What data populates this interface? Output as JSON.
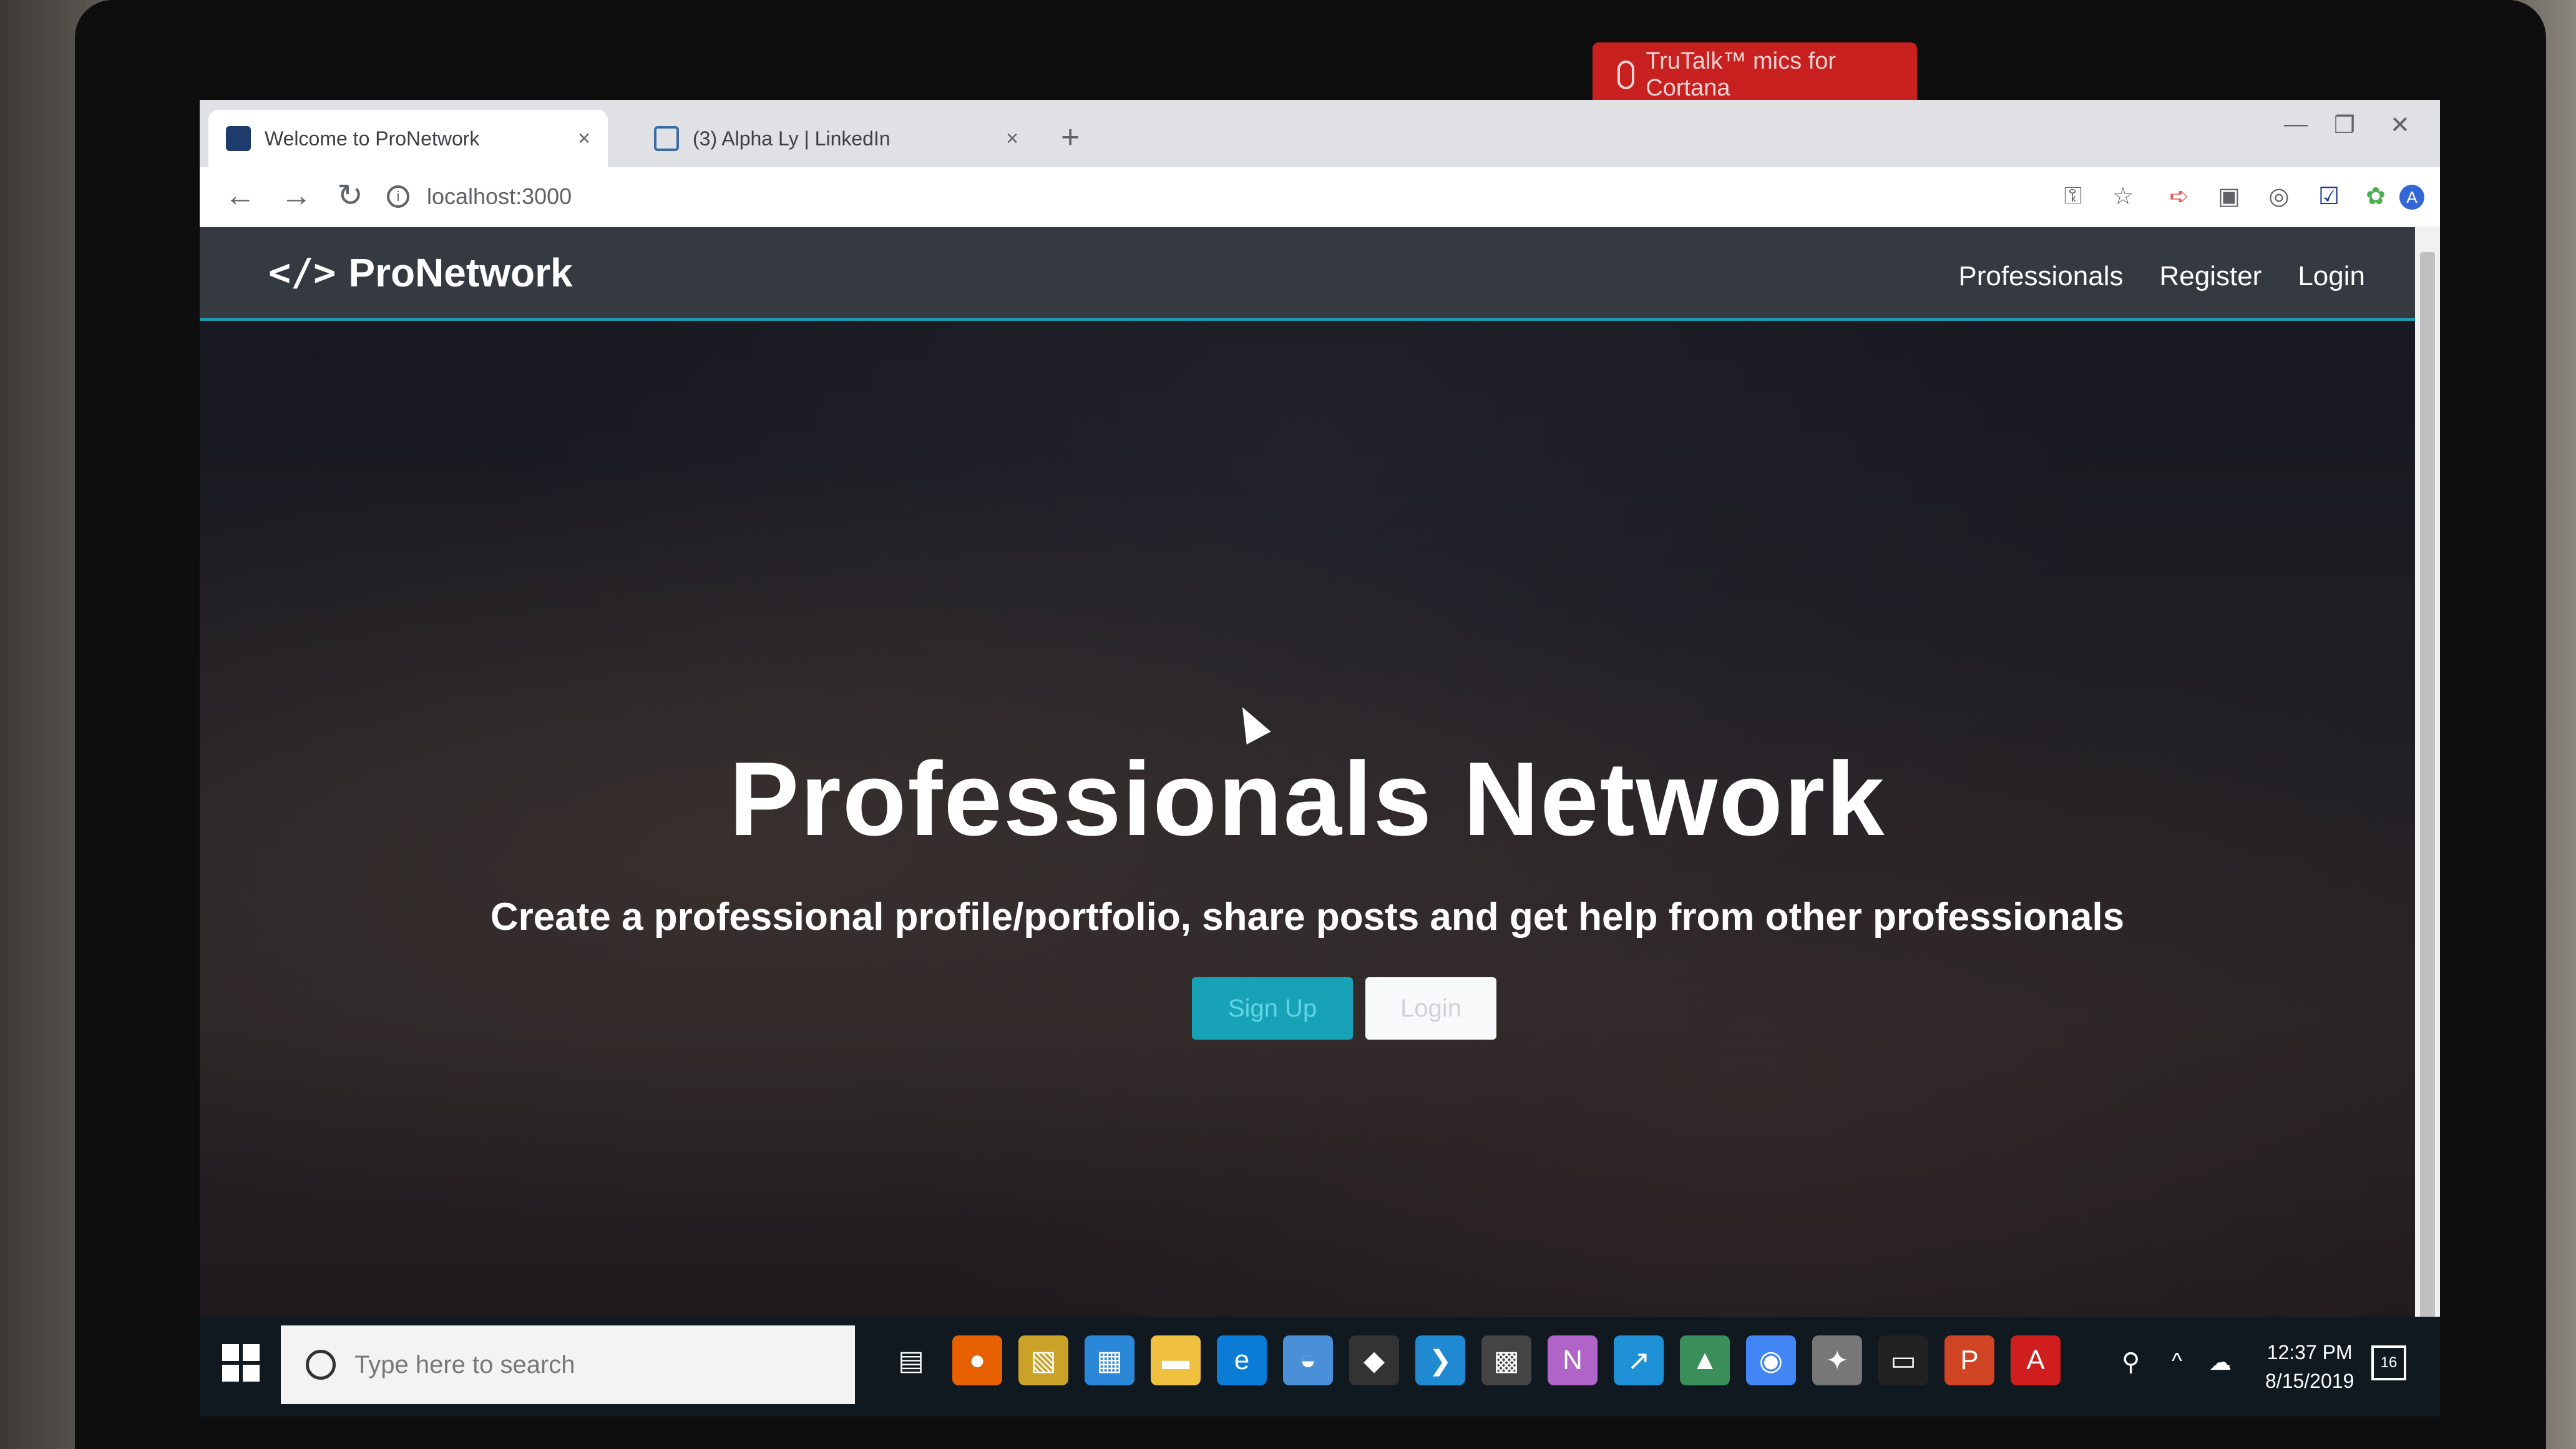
{
  "badge": {
    "text": "TruTalk™ mics for Cortana"
  },
  "browser": {
    "tabs": [
      {
        "title": "Welcome to ProNetwork",
        "active": true
      },
      {
        "title": "(3) Alpha Ly | LinkedIn",
        "active": false
      }
    ],
    "close_glyph": "×",
    "new_tab_glyph": "+",
    "address": "localhost:3000",
    "info_glyph": "i",
    "back_glyph": "←",
    "forward_glyph": "→",
    "reload_glyph": "↻",
    "profile_initial": "A",
    "window_controls": {
      "minimize": "—",
      "restore": "❐",
      "close": "✕"
    },
    "toolbar_icons": {
      "key": "⚿",
      "star": "☆",
      "menu": "⋮"
    }
  },
  "site": {
    "brand": {
      "icon": "</>",
      "name": "ProNetwork"
    },
    "nav": [
      "Professionals",
      "Register",
      "Login"
    ],
    "hero": {
      "title": "Professionals Network",
      "subtitle": "Create a professional profile/portfolio, share posts and get help from other professionals",
      "signup_label": "Sign Up",
      "login_label": "Login"
    }
  },
  "taskbar": {
    "search_placeholder": "Type here to search",
    "time": "12:37 PM",
    "date": "8/15/2019",
    "notification_count": "16",
    "apps": [
      {
        "name": "task-view",
        "glyph": "▤",
        "color": "#101820"
      },
      {
        "name": "firefox",
        "glyph": "●",
        "color": "#e66000"
      },
      {
        "name": "notes",
        "glyph": "▧",
        "color": "#c9a227"
      },
      {
        "name": "store",
        "glyph": "▦",
        "color": "#2b88d8"
      },
      {
        "name": "file-explorer",
        "glyph": "▬",
        "color": "#f0c040"
      },
      {
        "name": "edge",
        "glyph": "e",
        "color": "#0a7cd6"
      },
      {
        "name": "disc",
        "glyph": "◒",
        "color": "#4a90d9"
      },
      {
        "name": "git",
        "glyph": "◆",
        "color": "#333333"
      },
      {
        "name": "vscode",
        "glyph": "❯",
        "color": "#1f8ad2"
      },
      {
        "name": "movies",
        "glyph": "▩",
        "color": "#444444"
      },
      {
        "name": "onenote",
        "glyph": "N",
        "color": "#b064c8"
      },
      {
        "name": "teams",
        "glyph": "↗",
        "color": "#1e90d6"
      },
      {
        "name": "android",
        "glyph": "▲",
        "color": "#3a8f5a"
      },
      {
        "name": "chrome",
        "glyph": "◉",
        "color": "#4285f4"
      },
      {
        "name": "app-settings",
        "glyph": "✦",
        "color": "#777777"
      },
      {
        "name": "terminal",
        "glyph": "▭",
        "color": "#222222"
      },
      {
        "name": "powerpoint",
        "glyph": "P",
        "color": "#d04423"
      },
      {
        "name": "acrobat",
        "glyph": "A",
        "color": "#d01e1e"
      }
    ]
  }
}
